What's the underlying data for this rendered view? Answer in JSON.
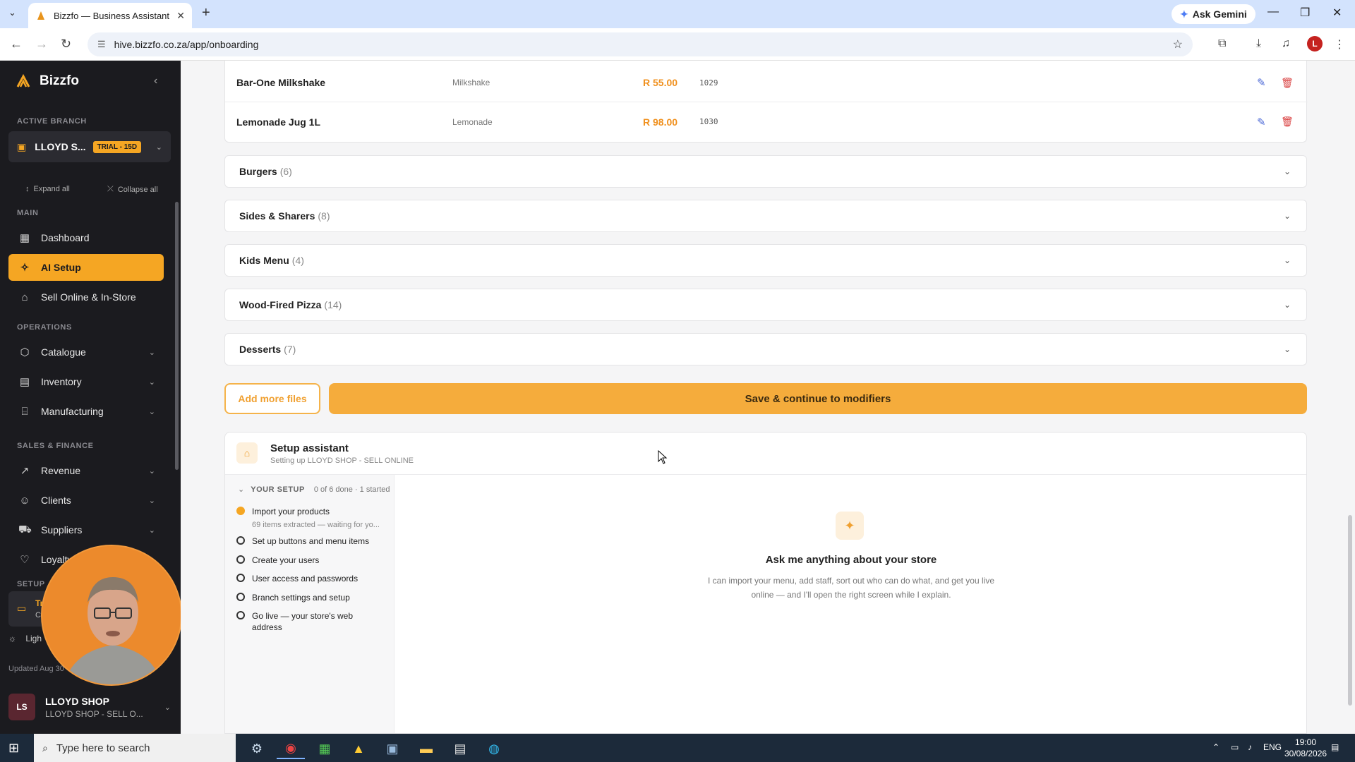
{
  "browser": {
    "tab_title": "Bizzfo — Business Assistant",
    "new_tab": "+",
    "gemini_label": "Ask Gemini",
    "url": "hive.bizzfo.co.za/app/onboarding",
    "profile_initial": "L"
  },
  "sidebar": {
    "brand": "Bizzfo",
    "active_branch_label": "ACTIVE BRANCH",
    "branch_name": "LLOYD S...",
    "branch_badge": "TRIAL - 15D",
    "expand_all": "Expand all",
    "collapse_all": "Collapse all",
    "section_main": "MAIN",
    "section_operations": "OPERATIONS",
    "section_sales": "SALES & FINANCE",
    "section_setup": "SETUP",
    "items": [
      {
        "label": "Dashboard",
        "icon": "grid-icon"
      },
      {
        "label": "AI Setup",
        "icon": "sparkle-icon"
      },
      {
        "label": "Sell Online & In-Store",
        "icon": "store-icon"
      },
      {
        "label": "Catalogue",
        "icon": "box-icon"
      },
      {
        "label": "Inventory",
        "icon": "inventory-icon"
      },
      {
        "label": "Manufacturing",
        "icon": "factory-icon"
      },
      {
        "label": "Revenue",
        "icon": "trend-icon"
      },
      {
        "label": "Clients",
        "icon": "users-icon"
      },
      {
        "label": "Suppliers",
        "icon": "truck-icon"
      },
      {
        "label": "Loyalty",
        "icon": "gift-icon"
      }
    ],
    "upgrade_partial": "Tr",
    "upgrade_partial2": "C",
    "light_label": "Ligh",
    "updated_label": "Updated Aug 30",
    "user_initials": "LS",
    "user_name": "LLOYD SHOP",
    "user_sub": "LLOYD SHOP - SELL O..."
  },
  "products": [
    {
      "name": "Bar-One Milkshake",
      "category": "Milkshake",
      "price": "R 55.00",
      "code": "1029"
    },
    {
      "name": "Lemonade Jug 1L",
      "category": "Lemonade",
      "price": "R 98.00",
      "code": "1030"
    }
  ],
  "categories": [
    {
      "name": "Burgers",
      "count": "(6)"
    },
    {
      "name": "Sides & Sharers",
      "count": "(8)"
    },
    {
      "name": "Kids Menu",
      "count": "(4)"
    },
    {
      "name": "Wood-Fired Pizza",
      "count": "(14)"
    },
    {
      "name": "Desserts",
      "count": "(7)"
    }
  ],
  "actions": {
    "add_files": "Add more files",
    "save_continue": "Save & continue to modifiers"
  },
  "assistant": {
    "title": "Setup assistant",
    "subtitle": "Setting up LLOYD SHOP - SELL ONLINE",
    "your_setup": "YOUR SETUP",
    "progress": "0 of 6 done · 1 started",
    "steps": [
      {
        "label": "Import your products",
        "sub": "69 items extracted — waiting for yo...",
        "state": "active"
      },
      {
        "label": "Set up buttons and menu items",
        "state": "todo"
      },
      {
        "label": "Create your users",
        "state": "todo"
      },
      {
        "label": "User access and passwords",
        "state": "todo"
      },
      {
        "label": "Branch settings and setup",
        "state": "todo"
      },
      {
        "label": "Go live — your store's web address",
        "state": "todo"
      }
    ],
    "ask_title": "Ask me anything about your store",
    "ask_sub": "I can import your menu, add staff, sort out who can do what, and get you live online — and I'll open the right screen while I explain."
  },
  "taskbar": {
    "search_placeholder": "Type here to search",
    "lang": "ENG",
    "time": "19:00",
    "date": "30/08/2026"
  },
  "colors": {
    "accent": "#f5a623",
    "sidebar_bg": "#1b1b1f",
    "price": "#f0901d"
  }
}
